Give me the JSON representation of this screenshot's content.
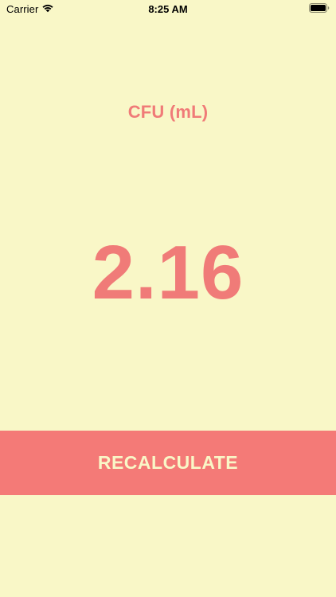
{
  "status_bar": {
    "carrier": "Carrier",
    "time": "8:25 AM",
    "wifi_icon": "wifi-icon",
    "battery_icon": "battery-icon"
  },
  "main": {
    "unit_label": "CFU (mL)",
    "result_value": "2.16",
    "recalculate_label": "RECALCULATE"
  },
  "colors": {
    "background": "#f9f7c7",
    "accent": "#f47a77"
  }
}
